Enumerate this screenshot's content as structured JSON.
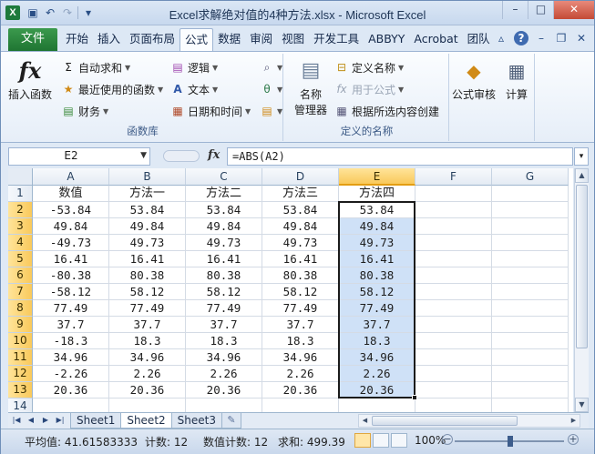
{
  "window": {
    "title": "Excel求解绝对值的4种方法.xlsx - Microsoft Excel",
    "app_icon": "X",
    "controls": {
      "minimize": "–",
      "maximize": "□",
      "close": "✕"
    }
  },
  "ribbon_tabs": {
    "file": "文件",
    "tabs": [
      "开始",
      "插入",
      "页面布局",
      "公式",
      "数据",
      "审阅",
      "视图",
      "开发工具",
      "ABBYY",
      "Acrobat",
      "团队"
    ],
    "active_index": 3
  },
  "ribbon": {
    "function_library": {
      "label": "函数库",
      "insert_function": "插入函数",
      "autosum": "自动求和",
      "recent": "最近使用的函数",
      "financial": "财务",
      "logical": "逻辑",
      "text": "文本",
      "datetime": "日期和时间"
    },
    "defined_names": {
      "label": "定义的名称",
      "name_manager_line1": "名称",
      "name_manager_line2": "管理器",
      "define_name": "定义名称",
      "use_in_formula": "用于公式",
      "create_from_selection": "根据所选内容创建"
    },
    "formula_auditing": "公式审核",
    "calculation": "计算"
  },
  "formula_bar": {
    "name_box": "E2",
    "fx": "fx",
    "formula": "=ABS(A2)"
  },
  "grid": {
    "columns": [
      "A",
      "B",
      "C",
      "D",
      "E",
      "F",
      "G"
    ],
    "selected_column": "E",
    "rows": [
      "1",
      "2",
      "3",
      "4",
      "5",
      "6",
      "7",
      "8",
      "9",
      "10",
      "11",
      "12",
      "13",
      "14"
    ],
    "headers": [
      "数值",
      "方法一",
      "方法二",
      "方法三",
      "方法四"
    ],
    "data": [
      [
        "-53.84",
        "53.84",
        "53.84",
        "53.84",
        "53.84"
      ],
      [
        "49.84",
        "49.84",
        "49.84",
        "49.84",
        "49.84"
      ],
      [
        "-49.73",
        "49.73",
        "49.73",
        "49.73",
        "49.73"
      ],
      [
        "16.41",
        "16.41",
        "16.41",
        "16.41",
        "16.41"
      ],
      [
        "-80.38",
        "80.38",
        "80.38",
        "80.38",
        "80.38"
      ],
      [
        "-58.12",
        "58.12",
        "58.12",
        "58.12",
        "58.12"
      ],
      [
        "77.49",
        "77.49",
        "77.49",
        "77.49",
        "77.49"
      ],
      [
        "37.7",
        "37.7",
        "37.7",
        "37.7",
        "37.7"
      ],
      [
        "-18.3",
        "18.3",
        "18.3",
        "18.3",
        "18.3"
      ],
      [
        "34.96",
        "34.96",
        "34.96",
        "34.96",
        "34.96"
      ],
      [
        "-2.26",
        "2.26",
        "2.26",
        "2.26",
        "2.26"
      ],
      [
        "20.36",
        "20.36",
        "20.36",
        "20.36",
        "20.36"
      ]
    ],
    "selection": "E2:E13"
  },
  "sheet_tabs": {
    "tabs": [
      "Sheet1",
      "Sheet2",
      "Sheet3"
    ],
    "active_index": 1
  },
  "status_bar": {
    "average": "平均值: 41.61583333",
    "count": "计数: 12",
    "numeric_count": "数值计数: 12",
    "sum": "求和: 499.39",
    "zoom": "100%"
  },
  "colors": {
    "selection_fill": "#cfe1f7",
    "selected_header": "#f9c95b",
    "file_tab": "#1f7532"
  }
}
